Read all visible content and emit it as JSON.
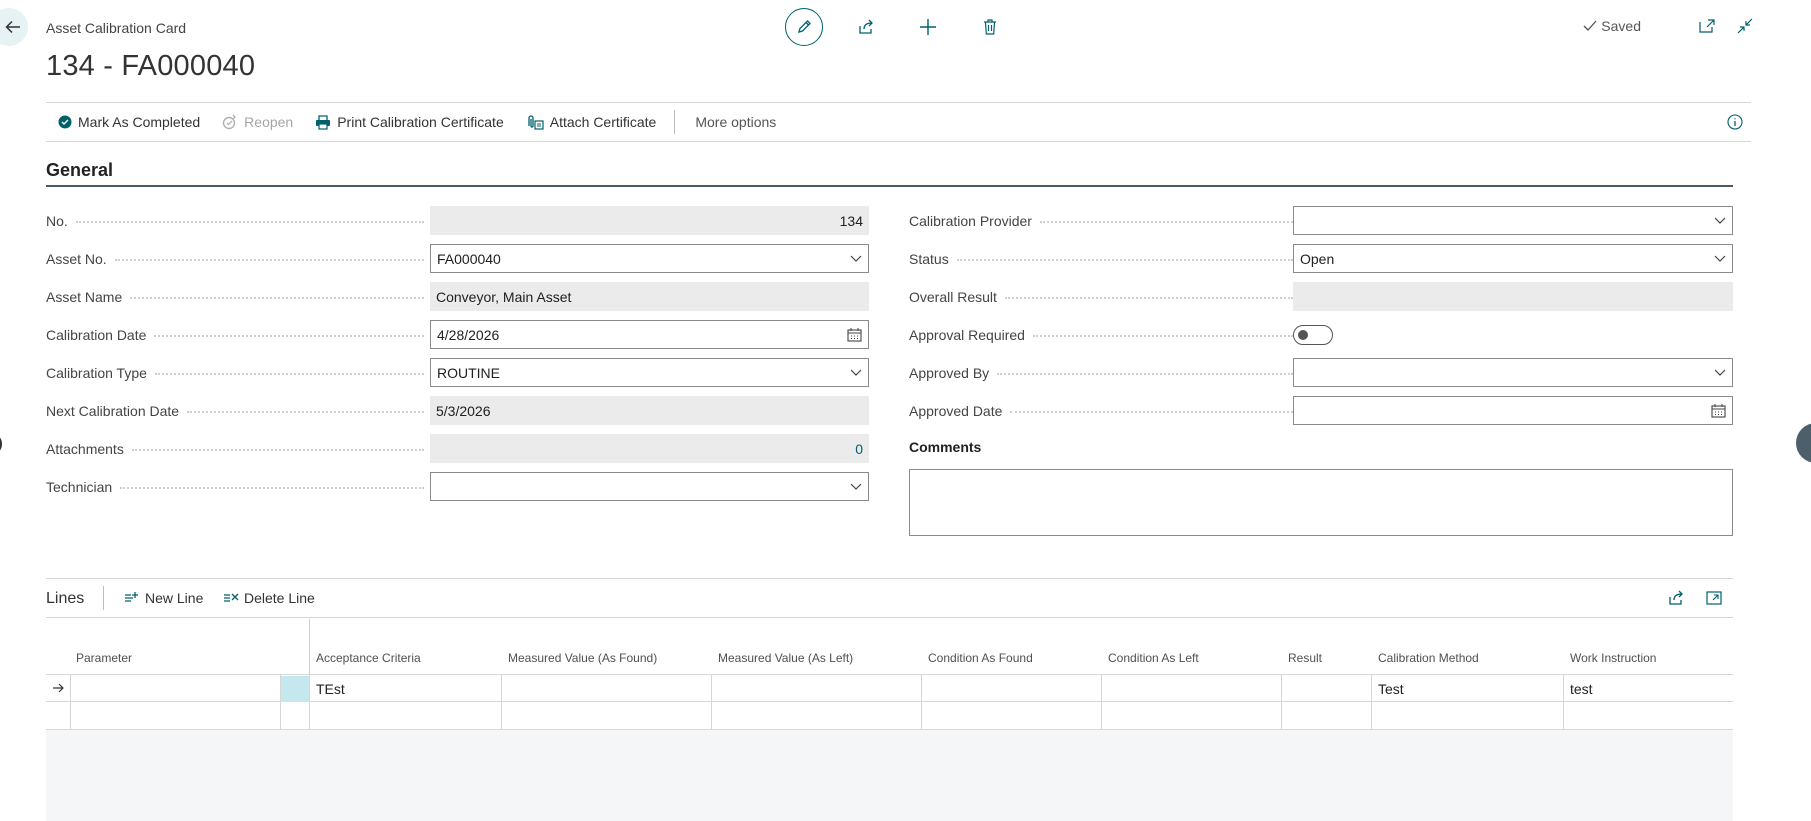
{
  "header": {
    "breadcrumb": "Asset Calibration Card",
    "title": "134 - FA000040",
    "saved_label": "Saved"
  },
  "action_bar": {
    "mark_completed": "Mark As Completed",
    "reopen": "Reopen",
    "print_certificate": "Print Calibration Certificate",
    "attach_certificate": "Attach Certificate",
    "more_options": "More options"
  },
  "general": {
    "section_title": "General",
    "left_fields": {
      "no": {
        "label": "No.",
        "value": "134"
      },
      "asset_no": {
        "label": "Asset No.",
        "value": "FA000040"
      },
      "asset_name": {
        "label": "Asset Name",
        "value": "Conveyor, Main Asset"
      },
      "calibration_date": {
        "label": "Calibration Date",
        "value": "4/28/2026"
      },
      "calibration_type": {
        "label": "Calibration Type",
        "value": "ROUTINE"
      },
      "next_calibration_date": {
        "label": "Next Calibration Date",
        "value": "5/3/2026"
      },
      "attachments": {
        "label": "Attachments",
        "value": "0"
      },
      "technician": {
        "label": "Technician",
        "value": ""
      }
    },
    "right_fields": {
      "calibration_provider": {
        "label": "Calibration Provider",
        "value": ""
      },
      "status": {
        "label": "Status",
        "value": "Open"
      },
      "overall_result": {
        "label": "Overall Result",
        "value": ""
      },
      "approval_required": {
        "label": "Approval Required",
        "value": false
      },
      "approved_by": {
        "label": "Approved By",
        "value": ""
      },
      "approved_date": {
        "label": "Approved Date",
        "value": ""
      }
    },
    "comments_label": "Comments",
    "comments_value": ""
  },
  "lines": {
    "title": "Lines",
    "new_line": "New Line",
    "delete_line": "Delete Line",
    "columns": [
      "Parameter",
      "Acceptance Criteria",
      "Measured Value (As Found)",
      "Measured Value (As Left)",
      "Condition As Found",
      "Condition As Left",
      "Result",
      "Calibration Method",
      "Work Instruction"
    ],
    "rows": [
      {
        "parameter": "",
        "acceptance_criteria": "TEst",
        "measured_found": "",
        "measured_left": "",
        "condition_found": "",
        "condition_left": "",
        "result": "",
        "calibration_method": "Test",
        "work_instruction": "test"
      },
      {
        "parameter": "",
        "acceptance_criteria": "",
        "measured_found": "",
        "measured_left": "",
        "condition_found": "",
        "condition_left": "",
        "result": "",
        "calibration_method": "",
        "work_instruction": ""
      }
    ]
  },
  "colors": {
    "accent": "#00606b",
    "selected_cell": "#c5e7ee",
    "readonly_bg": "#ebebeb"
  }
}
